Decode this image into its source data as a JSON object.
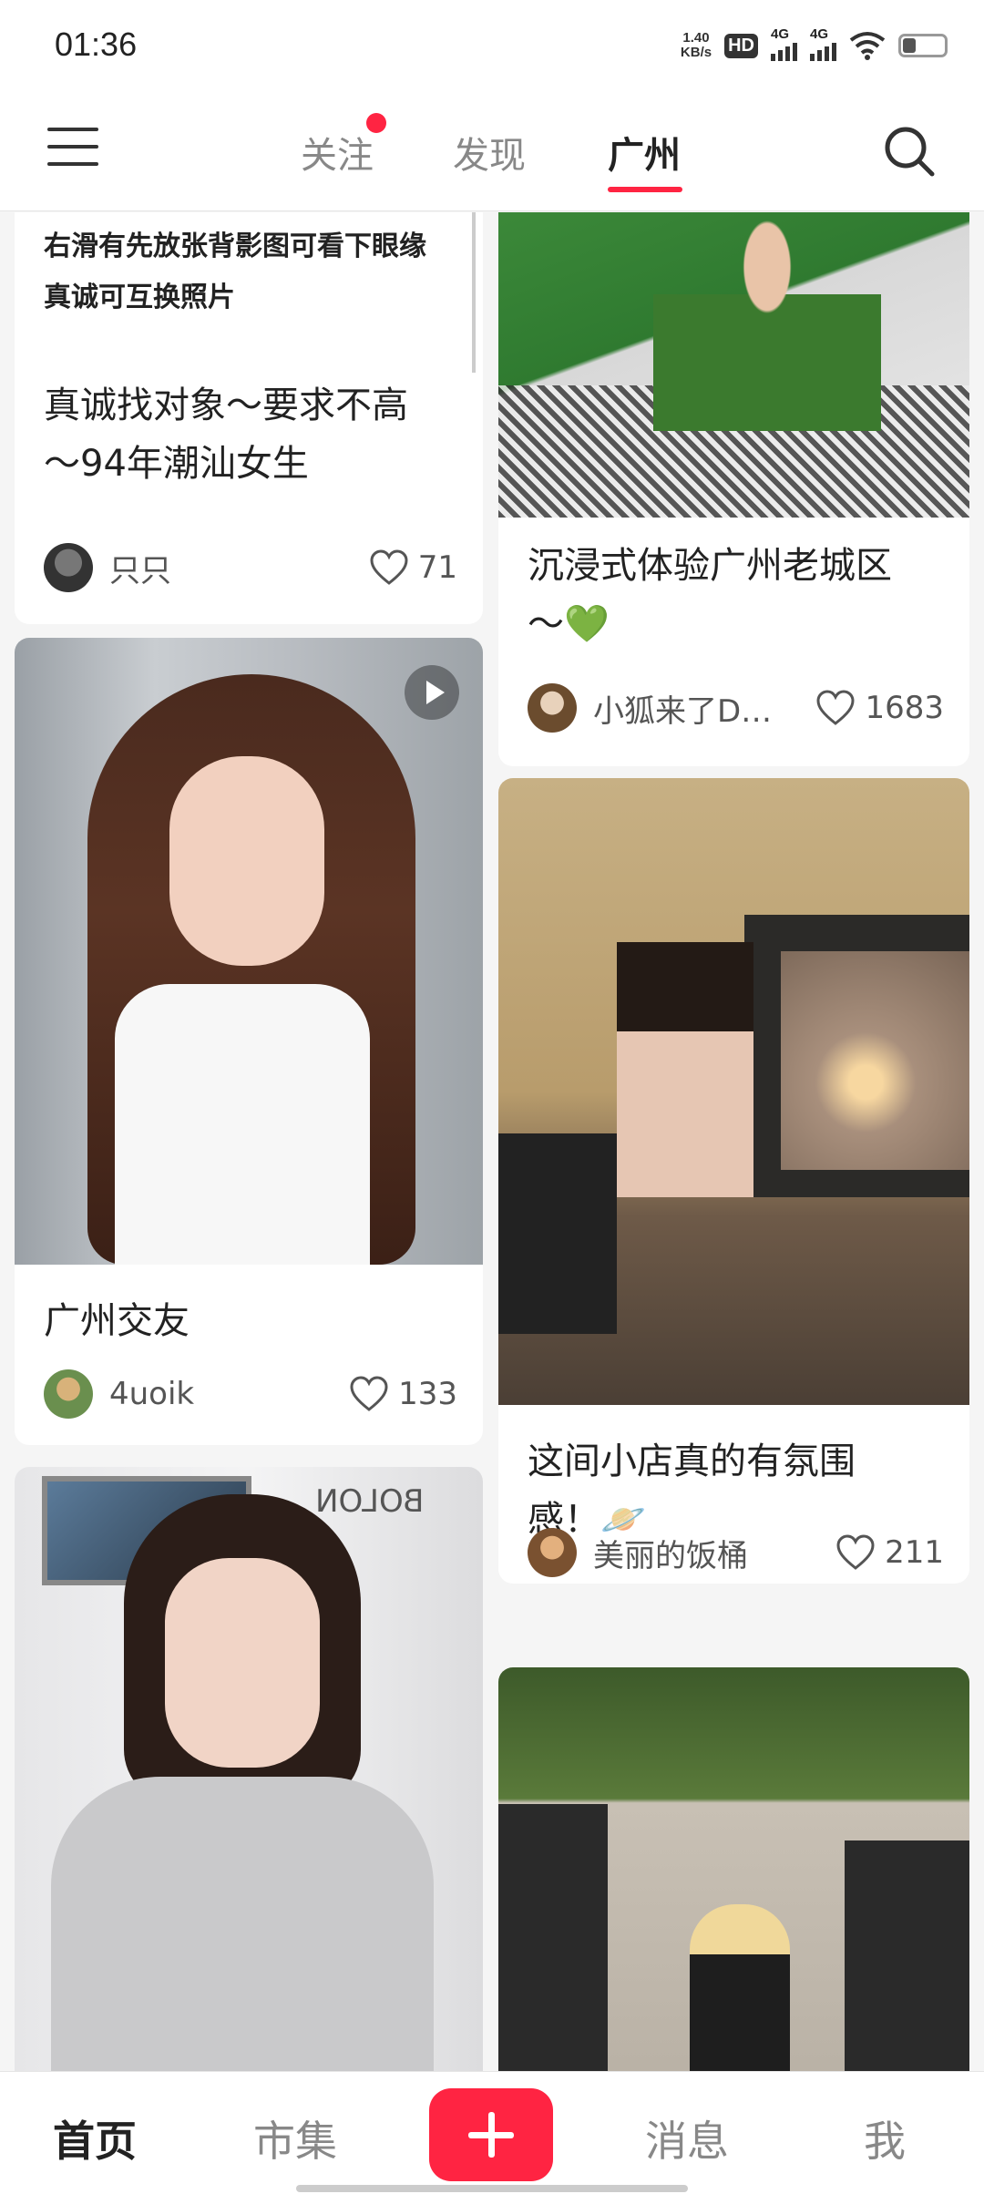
{
  "status": {
    "time": "01:36",
    "speed_value": "1.40",
    "speed_unit": "KB/s",
    "hd": "HD",
    "net1": "4G",
    "net2": "4G"
  },
  "tabs": [
    {
      "label": "关注",
      "has_dot": true
    },
    {
      "label": "发现"
    },
    {
      "label": "广州",
      "active": true
    }
  ],
  "cards": [
    {
      "desc_line1": "右滑有先放张背影图可看下眼缘",
      "desc_line2": "真诚可互换照片",
      "title_line1": "真诚找对象～要求不高",
      "title_line2": "～94年潮汕女生",
      "author": "只只",
      "likes": "71"
    },
    {
      "title_line1": "沉浸式体验广州老城区",
      "title_line2": "～💚",
      "author": "小狐来了D…",
      "likes": "1683"
    },
    {
      "title_line1": "广州交友",
      "author": "4uoik",
      "likes": "133",
      "is_video": true
    },
    {
      "title_line1": "这间小店真的有氛围",
      "title_line2": "感！🪐",
      "author": "美丽的饭桶",
      "likes": "211"
    },
    {
      "image_text": "BOLON"
    },
    {}
  ],
  "bottom_nav": [
    {
      "label": "首页",
      "active": true
    },
    {
      "label": "市集"
    },
    {
      "label": "消息"
    },
    {
      "label": "我"
    }
  ],
  "colors": {
    "accent": "#ff2442"
  }
}
